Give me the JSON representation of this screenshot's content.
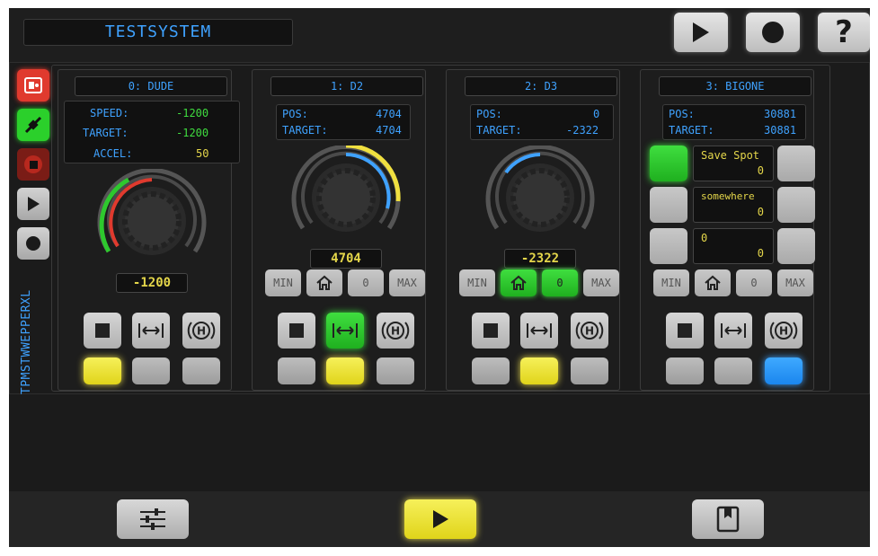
{
  "app": {
    "title": "TESTSYSTEM"
  },
  "toolbar": {
    "play_icon": "play-icon",
    "record_icon": "record-icon",
    "help_label": "?"
  },
  "sidebar": {
    "vertical_label": "TPMSTWWEPPERXL",
    "icons": [
      "disconnect-icon",
      "plug-icon",
      "stop-icon",
      "play-icon",
      "record-icon"
    ]
  },
  "motors": [
    {
      "name": "0: DUDE",
      "info": [
        {
          "label": "SPEED:",
          "value": "-1200"
        },
        {
          "label": "TARGET:",
          "value": "-1200"
        },
        {
          "label": "ACCEL:",
          "value": "50"
        }
      ],
      "position": "-1200",
      "toggles": [
        "",
        "",
        ""
      ]
    },
    {
      "name": "1: D2",
      "info": [
        {
          "label": "POS:",
          "value": "4704"
        },
        {
          "label": "TARGET:",
          "value": "4704"
        }
      ],
      "position": "4704",
      "buttons": {
        "min": "MIN",
        "zero": "0",
        "max": "MAX"
      }
    },
    {
      "name": "2: D3",
      "info": [
        {
          "label": "POS:",
          "value": "0"
        },
        {
          "label": "TARGET:",
          "value": "-2322"
        }
      ],
      "position": "-2322",
      "buttons": {
        "min": "MIN",
        "zero": "0",
        "max": "MAX"
      }
    },
    {
      "name": "3: BIGONE",
      "info": [
        {
          "label": "POS:",
          "value": "30881"
        },
        {
          "label": "TARGET:",
          "value": "30881"
        }
      ],
      "spots": [
        {
          "name": "Save Spot",
          "value": "0"
        },
        {
          "name": "somewhere",
          "value": "0"
        },
        {
          "name": "0",
          "value": "0"
        }
      ],
      "buttons": {
        "min": "MIN",
        "zero": "0",
        "max": "MAX"
      }
    }
  ],
  "bottom": {
    "left_icon": "sliders-icon",
    "center_icon": "play-icon",
    "right_icon": "bookmark-icon"
  },
  "colors": {
    "accent_blue": "#3fa2ff",
    "accent_yellow": "#e4d64a",
    "accent_green": "#3fdc3f",
    "alert_red": "#e03a2e"
  }
}
